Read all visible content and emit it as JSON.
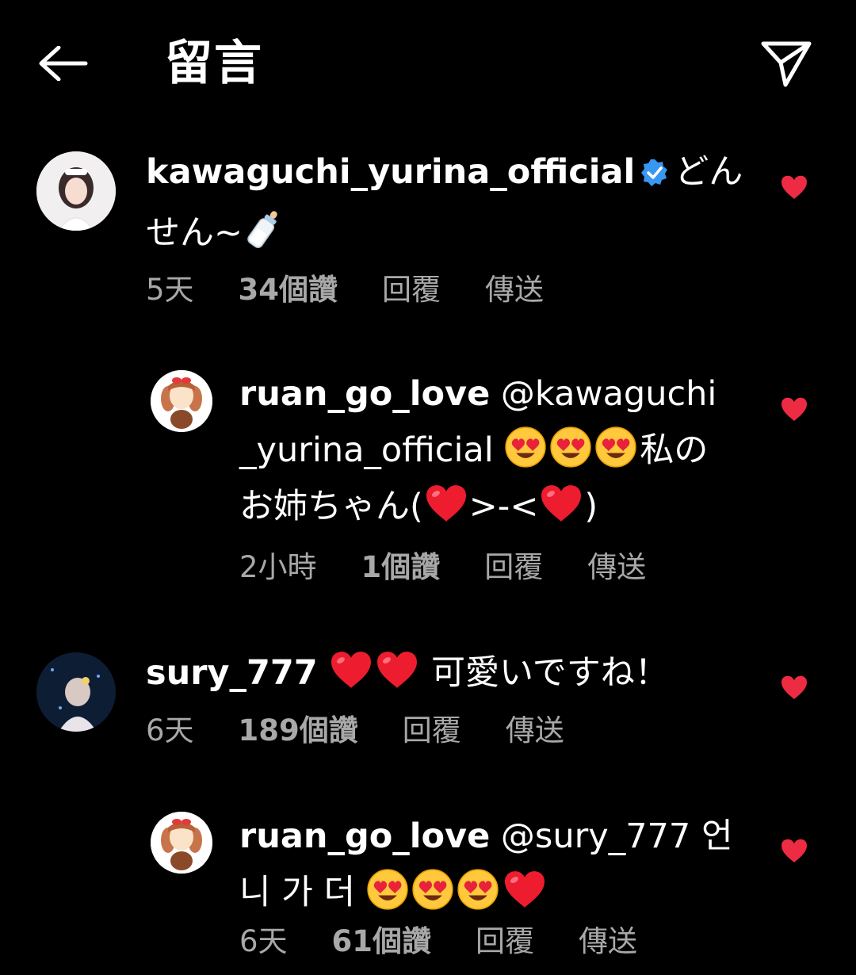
{
  "header": {
    "title": "留言",
    "back_icon": "arrow-left-icon",
    "send_icon": "paper-plane-icon"
  },
  "colors": {
    "background": "#000000",
    "text": "#ffffff",
    "meta": "#a8a8a8",
    "like": "#ed2b43",
    "verified": "#3897f0"
  },
  "comments": [
    {
      "username": "kawaguchi_yurina_official",
      "verified": true,
      "text_line1": "どん",
      "text_line2": "せん~",
      "time": "5天",
      "likes": "34個讚",
      "reply": "回覆",
      "send": "傳送"
    },
    {
      "username": "ruan_go_love",
      "mention_part1": "@kawaguchi",
      "mention_part2": "_yurina_official",
      "text_after_emoji": "私の",
      "text_line3_a": "お姉ちゃん(",
      "text_line3_b": ">-<",
      "text_line3_c": ")",
      "time": "2小時",
      "likes": "1個讚",
      "reply": "回覆",
      "send": "傳送"
    },
    {
      "username": "sury_777",
      "text": "可愛いですね！",
      "time": "6天",
      "likes": "189個讚",
      "reply": "回覆",
      "send": "傳送"
    },
    {
      "username": "ruan_go_love",
      "mention": "@sury_777",
      "text_end": "언",
      "text_line2": "니 가 더",
      "time": "6天",
      "likes": "61個讚",
      "reply": "回覆",
      "send": "傳送"
    }
  ]
}
